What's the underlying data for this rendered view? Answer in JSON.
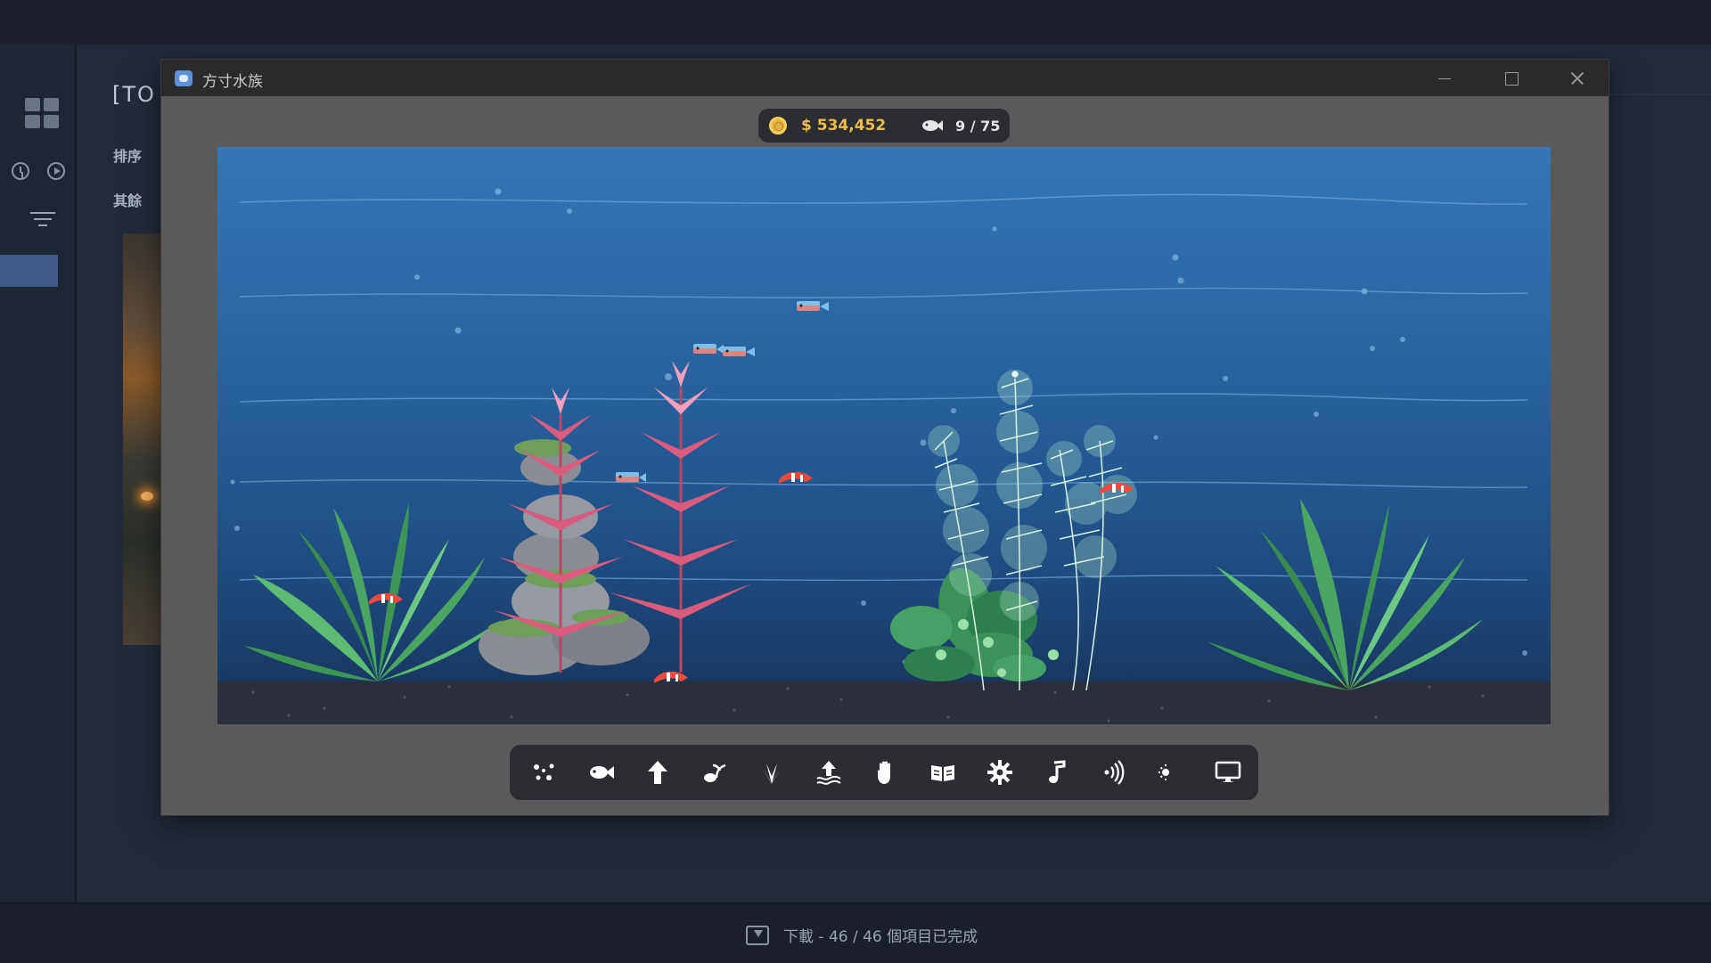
{
  "launcher": {
    "title_partial": "[TO",
    "sort_label": "排序",
    "other_label": "其餘",
    "download_status": "下載 - 46 / 46 個項目已完成"
  },
  "window": {
    "title": "方寸水族",
    "controls": [
      "minimize",
      "maximize",
      "close"
    ]
  },
  "hud": {
    "money": "$ 534,452",
    "fish_count": "9 / 75",
    "coin_color": "#e3b140"
  },
  "toolbar": {
    "tools": [
      {
        "icon": "scatter-dots-icon"
      },
      {
        "icon": "fish-icon"
      },
      {
        "icon": "arrow-up-icon"
      },
      {
        "icon": "plant-seedling-icon"
      },
      {
        "icon": "grass-icon"
      },
      {
        "icon": "water-level-up-icon"
      },
      {
        "icon": "hand-icon"
      },
      {
        "icon": "book-icon"
      },
      {
        "icon": "settings-gear-icon"
      },
      {
        "icon": "music-note-icon"
      },
      {
        "icon": "sound-waves-icon"
      },
      {
        "icon": "day-night-icon"
      },
      {
        "icon": "monitor-icon"
      }
    ]
  },
  "colors": {
    "water_top": "#3377b7",
    "water_bottom": "#152f52",
    "gravel": "#2a2d38",
    "plant_green": "#3f9d5f",
    "plant_pink": "#d95b7d",
    "hud_background": "#2b2d33"
  }
}
